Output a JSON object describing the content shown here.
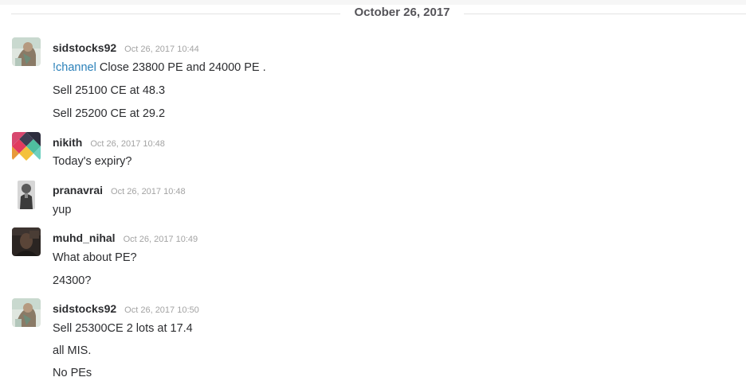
{
  "divider": {
    "date": "October 26, 2017"
  },
  "messages": [
    {
      "user": "sidstocks92",
      "time": "Oct 26, 2017 10:44",
      "lines": [
        {
          "mention": "!channel",
          "text": " Close 23800 PE and 24000 PE ."
        },
        {
          "text": "Sell 25100 CE at 48.3"
        },
        {
          "text": "Sell 25200 CE at 29.2"
        }
      ]
    },
    {
      "user": "nikith",
      "time": "Oct 26, 2017 10:48",
      "lines": [
        {
          "text": "Today's expiry?"
        }
      ]
    },
    {
      "user": "pranavrai",
      "time": "Oct 26, 2017 10:48",
      "lines": [
        {
          "text": "yup"
        }
      ]
    },
    {
      "user": "muhd_nihal",
      "time": "Oct 26, 2017 10:49",
      "lines": [
        {
          "text": "What about PE?"
        },
        {
          "text": "24300?"
        }
      ]
    },
    {
      "user": "sidstocks92",
      "time": "Oct 26, 2017 10:50",
      "lines": [
        {
          "text": "Sell 25300CE 2 lots at 17.4"
        },
        {
          "text": "all MIS."
        },
        {
          "text": "No PEs"
        }
      ]
    }
  ],
  "colors": {
    "mention": "#2a80b9",
    "username": "#2c2d30",
    "timestamp": "#a3a3a3",
    "divider_rule": "#e3e3e3"
  },
  "avatars": {
    "sidstocks92": "photo-avatar",
    "nikith": "identicon-avatar",
    "pranavrai": "photo-avatar",
    "muhd_nihal": "photo-avatar"
  }
}
